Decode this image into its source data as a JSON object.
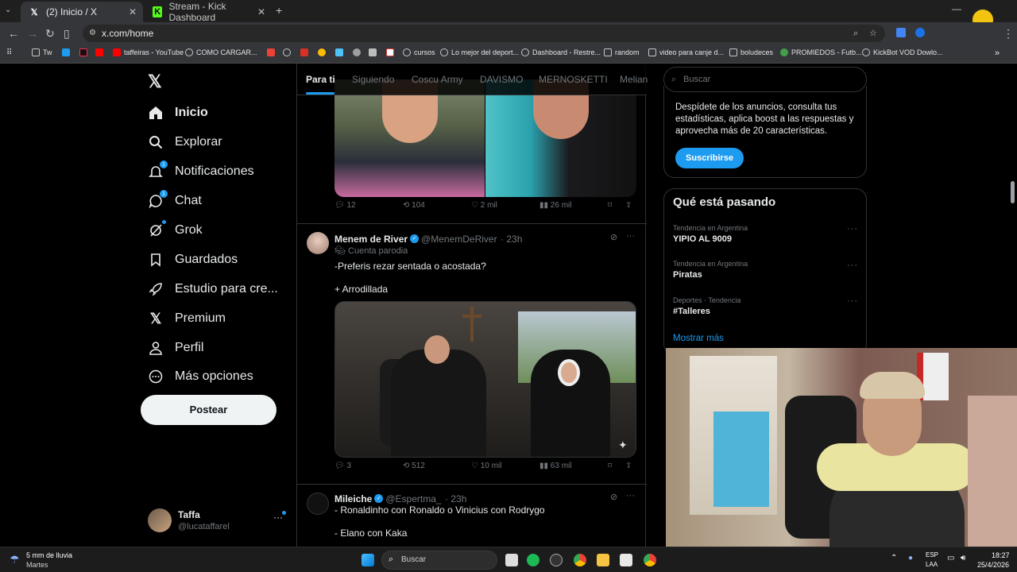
{
  "browser": {
    "tabs": [
      {
        "label": "(2) Inicio / X",
        "icon": "x-logo-icon"
      },
      {
        "label": "Stream - Kick Dashboard",
        "icon": "kick-icon"
      }
    ],
    "url": "x.com/home",
    "bookmarks": [
      "Tw",
      "taffeiras - YouTube",
      "COMO CARGAR...",
      "cursos",
      "Lo mejor del deport...",
      "Dashboard - Restre...",
      "random",
      "video para canje d...",
      "boludeces",
      "PROMIEDOS - Futb...",
      "KickBot VOD Dowlo..."
    ]
  },
  "sidebar": {
    "items": [
      {
        "label": "Inicio",
        "icon": "home-icon",
        "active": true
      },
      {
        "label": "Explorar",
        "icon": "search-icon"
      },
      {
        "label": "Notificaciones",
        "icon": "bell-icon",
        "badge": "1"
      },
      {
        "label": "Chat",
        "icon": "chat-icon",
        "badge": "1"
      },
      {
        "label": "Grok",
        "icon": "grok-icon"
      },
      {
        "label": "Guardados",
        "icon": "bookmark-icon"
      },
      {
        "label": "Estudio para cre...",
        "icon": "rocket-icon"
      },
      {
        "label": "Premium",
        "icon": "x-logo-icon"
      },
      {
        "label": "Perfil",
        "icon": "person-icon"
      },
      {
        "label": "Más opciones",
        "icon": "more-circle-icon"
      }
    ],
    "post_label": "Postear",
    "account": {
      "name": "Taffa",
      "handle": "@lucataffarel"
    }
  },
  "feed": {
    "tabs": [
      "Para ti",
      "Siguiendo",
      "Coscu Army",
      "DAVISMO",
      "MERNOSKETTI",
      "Melian"
    ],
    "tweet0": {
      "replies": "12",
      "reposts": "104",
      "likes": "2 mil",
      "views": "26 mil"
    },
    "tweet1": {
      "name": "Menem de River",
      "handle": "@MenemDeRiver",
      "time": "· 23h",
      "label": "Cuenta parodia",
      "line1": "-Preferis rezar sentada o acostada?",
      "line2": "+ Arrodillada",
      "replies": "3",
      "reposts": "512",
      "likes": "10 mil",
      "views": "63 mil"
    },
    "tweet2": {
      "name": "Mileiche",
      "handle": "@Espertma_",
      "time": "· 23h",
      "line1": "- Ronaldinho con Ronaldo o Vinicius con Rodrygo",
      "line2": "- Elano con Kaka"
    }
  },
  "right": {
    "search_placeholder": "Buscar",
    "premium_text": "Despídete de los anuncios, consulta tus estadísticas, aplica boost a las respuestas y aprovecha más de 20 características.",
    "subscribe_label": "Suscribirse",
    "trends_title": "Qué está pasando",
    "trends": [
      {
        "context": "Tendencia en Argentina",
        "name": "YIPIO AL 9009"
      },
      {
        "context": "Tendencia en Argentina",
        "name": "Piratas"
      },
      {
        "context": "Deportes · Tendencia",
        "name": "#Talleres"
      }
    ],
    "show_more": "Mostrar más"
  },
  "taskbar": {
    "weather_line1": "5 mm de lluvia",
    "weather_line2": "Martes",
    "search_label": "Buscar",
    "lang_line1": "ESP",
    "lang_line2": "LAA",
    "time": "18:27",
    "date": "25/4/2026"
  }
}
